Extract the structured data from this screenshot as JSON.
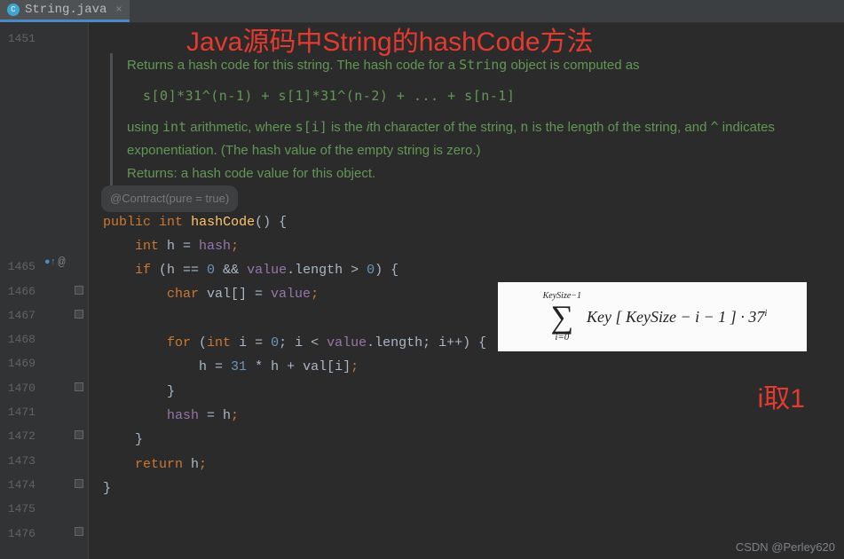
{
  "tab": {
    "name": "String.java",
    "icon_letter": "C"
  },
  "title_overlay": "Java源码中String的hashCode方法",
  "annotation_overlay": "i取1",
  "watermark": "CSDN @Perley620",
  "gutter": {
    "first_line": "1451",
    "lines": [
      "1465",
      "1466",
      "1467",
      "1468",
      "1469",
      "1470",
      "1471",
      "1472",
      "1473",
      "1474",
      "1475",
      "1476"
    ]
  },
  "doc": {
    "p1_a": "Returns a hash code for this string. The hash code for a ",
    "p1_code": "String",
    "p1_b": " object is computed as",
    "formula": "s[0]*31^(n-1) + s[1]*31^(n-2) + ... + s[n-1]",
    "p2_a": "using ",
    "p2_int": "int",
    "p2_b": " arithmetic, where ",
    "p2_si": "s[i]",
    "p2_c": " is the ",
    "p2_i": "i",
    "p2_d": "th character of the string, ",
    "p2_n": "n",
    "p2_e": " is the length of the string, and ",
    "p2_caret": "^",
    "p2_f": " indicates exponentiation. (The hash value of the empty string is zero.)",
    "returns_label": "Returns:",
    "returns_text": " a hash code value for this object."
  },
  "contract": "@Contract(pure = true)",
  "code": {
    "kw_public": "public",
    "kw_int": "int",
    "method": "hashCode",
    "sig_tail": "() {",
    "l2_a": "int",
    "l2_b": " h = ",
    "l2_hash": "hash",
    "l3_a": "if",
    "l3_b": " (h == ",
    "l3_zero1": "0",
    "l3_c": " && ",
    "l3_value": "value",
    "l3_d": ".length > ",
    "l3_zero2": "0",
    "l3_e": ") {",
    "l4_a": "char",
    "l4_b": " val[] = ",
    "l4_value": "value",
    "l6_a": "for",
    "l6_b": " (",
    "l6_int": "int",
    "l6_c": " i = ",
    "l6_zero": "0",
    "l6_d": "; i < ",
    "l6_value": "value",
    "l6_e": ".length; i++) {",
    "l7_a": "h = ",
    "l7_31": "31",
    "l7_b": " * h + val[i]",
    "l8": "}",
    "l9_a": "hash",
    "l9_b": " = h",
    "l10": "}",
    "l11_a": "return",
    "l11_b": " h",
    "l12": "}"
  },
  "overlay_formula": {
    "top": "KeySize−1",
    "bottom": "i=0",
    "expr_a": "Key",
    "expr_bracket": "[ KeySize − i − 1 ]",
    "expr_dot": " · 37",
    "expr_sup": "i"
  }
}
